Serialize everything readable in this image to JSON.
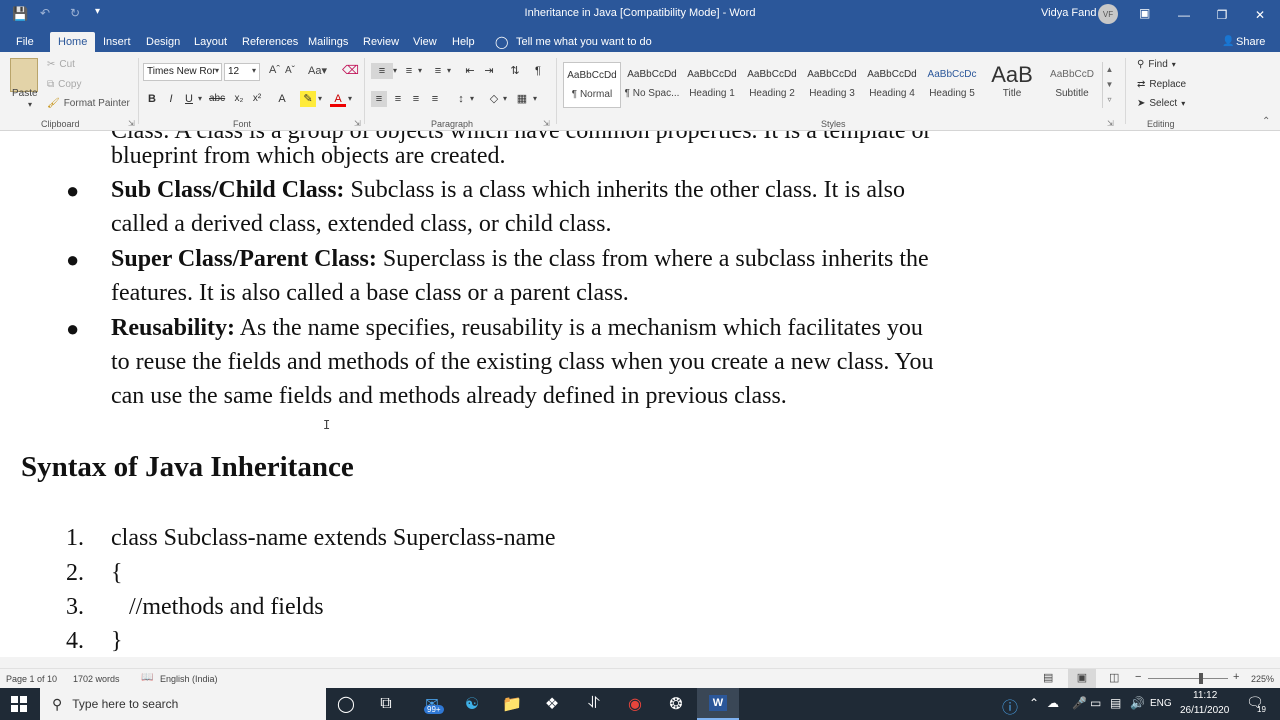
{
  "window": {
    "title": "Inheritance in Java [Compatibility Mode]  -  Word",
    "user_name": "Vidya Fand",
    "user_initials": "VF"
  },
  "ribbon_tabs": [
    "File",
    "Home",
    "Insert",
    "Design",
    "Layout",
    "References",
    "Mailings",
    "Review",
    "View",
    "Help"
  ],
  "tell_me": "Tell me what you want to do",
  "share": "Share",
  "clipboard": {
    "paste": "Paste",
    "cut": "Cut",
    "copy": "Copy",
    "format_painter": "Format Painter",
    "label": "Clipboard"
  },
  "font": {
    "name": "Times New Ror",
    "size": "12",
    "label": "Font"
  },
  "paragraph": {
    "label": "Paragraph"
  },
  "styles": {
    "label": "Styles",
    "items": [
      {
        "preview": "AaBbCcDd",
        "name": "¶ Normal"
      },
      {
        "preview": "AaBbCcDd",
        "name": "¶ No Spac..."
      },
      {
        "preview": "AaBbCcDd",
        "name": "Heading 1"
      },
      {
        "preview": "AaBbCcDd",
        "name": "Heading 2"
      },
      {
        "preview": "AaBbCcDd",
        "name": "Heading 3"
      },
      {
        "preview": "AaBbCcDd",
        "name": "Heading 4"
      },
      {
        "preview": "AaBbCcDc",
        "name": "Heading 5"
      },
      {
        "preview": "AaB",
        "name": "Title"
      },
      {
        "preview": "AaBbCcD",
        "name": "Subtitle"
      }
    ]
  },
  "editing": {
    "find": "Find",
    "replace": "Replace",
    "select": "Select",
    "label": "Editing"
  },
  "document": {
    "cut_top_line": "Class: A class is a group of objects which have common properties. It is a template or",
    "items": [
      {
        "lines": [
          {
            "bold": "",
            "text": "blueprint from which objects are created."
          }
        ],
        "bullet": false
      },
      {
        "lines": [
          {
            "bold": "Sub Class/Child Class:",
            "text": " Subclass is a class which inherits the other class. It is also"
          },
          {
            "bold": "",
            "text": "called a derived class, extended class, or child class."
          }
        ],
        "bullet": true
      },
      {
        "lines": [
          {
            "bold": "Super Class/Parent Class:",
            "text": " Superclass is the class from where a subclass inherits the"
          },
          {
            "bold": "",
            "text": "features. It is also called a base class or a parent class."
          }
        ],
        "bullet": true
      },
      {
        "lines": [
          {
            "bold": "Reusability:",
            "text": " As the name specifies, reusability is a mechanism which facilitates you"
          },
          {
            "bold": "",
            "text": "to reuse the fields and methods of the existing class when you create a new class. You"
          },
          {
            "bold": "",
            "text": "can use the same fields and methods already defined in previous class."
          }
        ],
        "bullet": true
      }
    ],
    "heading": "Syntax of Java Inheritance",
    "code": [
      {
        "num": "1.",
        "text": "class Subclass-name extends Superclass-name"
      },
      {
        "num": "2.",
        "text": "{"
      },
      {
        "num": "3.",
        "text": "   //methods and fields"
      },
      {
        "num": "4.",
        "text": "}"
      }
    ]
  },
  "status": {
    "page": "Page 1 of 10",
    "words": "1702 words",
    "language": "English (India)",
    "zoom": "225%"
  },
  "taskbar": {
    "search_placeholder": "Type here to search",
    "mail_badge": "99+",
    "lang": "ENG",
    "time": "11:12",
    "date": "26/11/2020",
    "notif_count": "19"
  }
}
